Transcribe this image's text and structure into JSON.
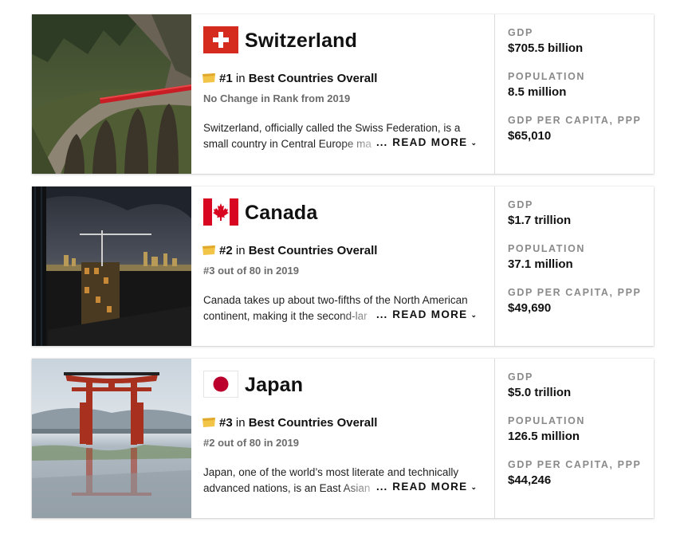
{
  "countries": [
    {
      "name": "Switzerland",
      "rank": "#1",
      "rank_in": "in",
      "rank_category": "Best Countries Overall",
      "rank_change": "No Change in Rank from 2019",
      "description_line1": "Switzerland, officially called the Swiss Federation, is a",
      "description_line2": "small country in Central Europe ma",
      "read_more": "READ MORE",
      "gdp_label": "GDP",
      "gdp_value": "$705.5 billion",
      "population_label": "POPULATION",
      "population_value": "8.5 million",
      "gdp_per_capita_label": "GDP PER CAPITA, PPP",
      "gdp_per_capita_value": "$65,010",
      "flag_icon": "switzerland-flag-icon",
      "photo_icon": "railway-viaduct-photo"
    },
    {
      "name": "Canada",
      "rank": "#2",
      "rank_in": "in",
      "rank_category": "Best Countries Overall",
      "rank_change": "#3 out of 80 in 2019",
      "description_line1": "Canada takes up about two-fifths of the North American",
      "description_line2": "continent, making it the second-lar",
      "read_more": "READ MORE",
      "gdp_label": "GDP",
      "gdp_value": "$1.7 trillion",
      "population_label": "POPULATION",
      "population_value": "37.1 million",
      "gdp_per_capita_label": "GDP PER CAPITA, PPP",
      "gdp_per_capita_value": "$49,690",
      "flag_icon": "canada-flag-icon",
      "photo_icon": "city-skyline-crane-photo"
    },
    {
      "name": "Japan",
      "rank": "#3",
      "rank_in": "in",
      "rank_category": "Best Countries Overall",
      "rank_change": "#2 out of 80 in 2019",
      "description_line1": "Japan, one of the world’s most literate and technically",
      "description_line2": "advanced nations, is an East Asian",
      "read_more": "READ MORE",
      "gdp_label": "GDP",
      "gdp_value": "$5.0 trillion",
      "population_label": "POPULATION",
      "population_value": "126.5 million",
      "gdp_per_capita_label": "GDP PER CAPITA, PPP",
      "gdp_per_capita_value": "$44,246",
      "flag_icon": "japan-flag-icon",
      "photo_icon": "torii-gate-photo"
    }
  ],
  "colors": {
    "swiss_red": "#d52b1e",
    "canada_red": "#d80621",
    "japan_red": "#bc002d",
    "medal_gold": "#f2c447",
    "label_gray": "#8a8a8a"
  }
}
